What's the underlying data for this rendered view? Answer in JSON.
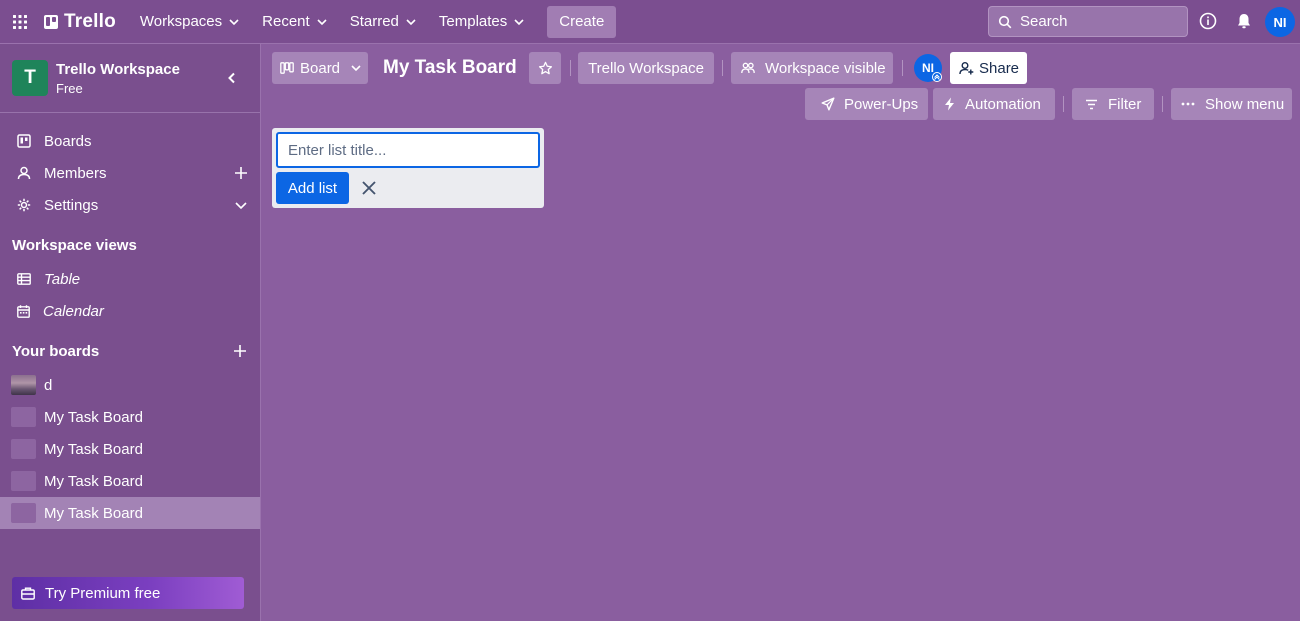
{
  "topbar": {
    "logo": "Trello",
    "nav": [
      {
        "label": "Workspaces"
      },
      {
        "label": "Recent"
      },
      {
        "label": "Starred"
      },
      {
        "label": "Templates"
      }
    ],
    "create": "Create",
    "search_placeholder": "Search",
    "avatar_initials": "NI"
  },
  "sidebar": {
    "workspace_initial": "T",
    "workspace_name": "Trello Workspace",
    "workspace_plan": "Free",
    "items": [
      {
        "label": "Boards"
      },
      {
        "label": "Members"
      },
      {
        "label": "Settings"
      }
    ],
    "views_title": "Workspace views",
    "views": [
      {
        "label": "Table"
      },
      {
        "label": "Calendar"
      }
    ],
    "boards_title": "Your boards",
    "boards": [
      {
        "label": "d"
      },
      {
        "label": "My Task Board"
      },
      {
        "label": "My Task Board"
      },
      {
        "label": "My Task Board"
      },
      {
        "label": "My Task Board"
      }
    ],
    "premium": "Try Premium free"
  },
  "board": {
    "view_label": "Board",
    "title": "My Task Board",
    "workspace_button": "Trello Workspace",
    "visibility": "Workspace visible",
    "member_initials": "NI",
    "share": "Share",
    "power_ups": "Power-Ups",
    "automation": "Automation",
    "filter": "Filter",
    "show_menu": "Show menu"
  },
  "composer": {
    "placeholder": "Enter list title...",
    "value": "",
    "add_label": "Add list"
  },
  "colors": {
    "board_bg": "#8a5e9f",
    "topbar_bg": "#7b4e90",
    "primary": "#0c66e4",
    "workspace_badge": "#1f845a"
  }
}
